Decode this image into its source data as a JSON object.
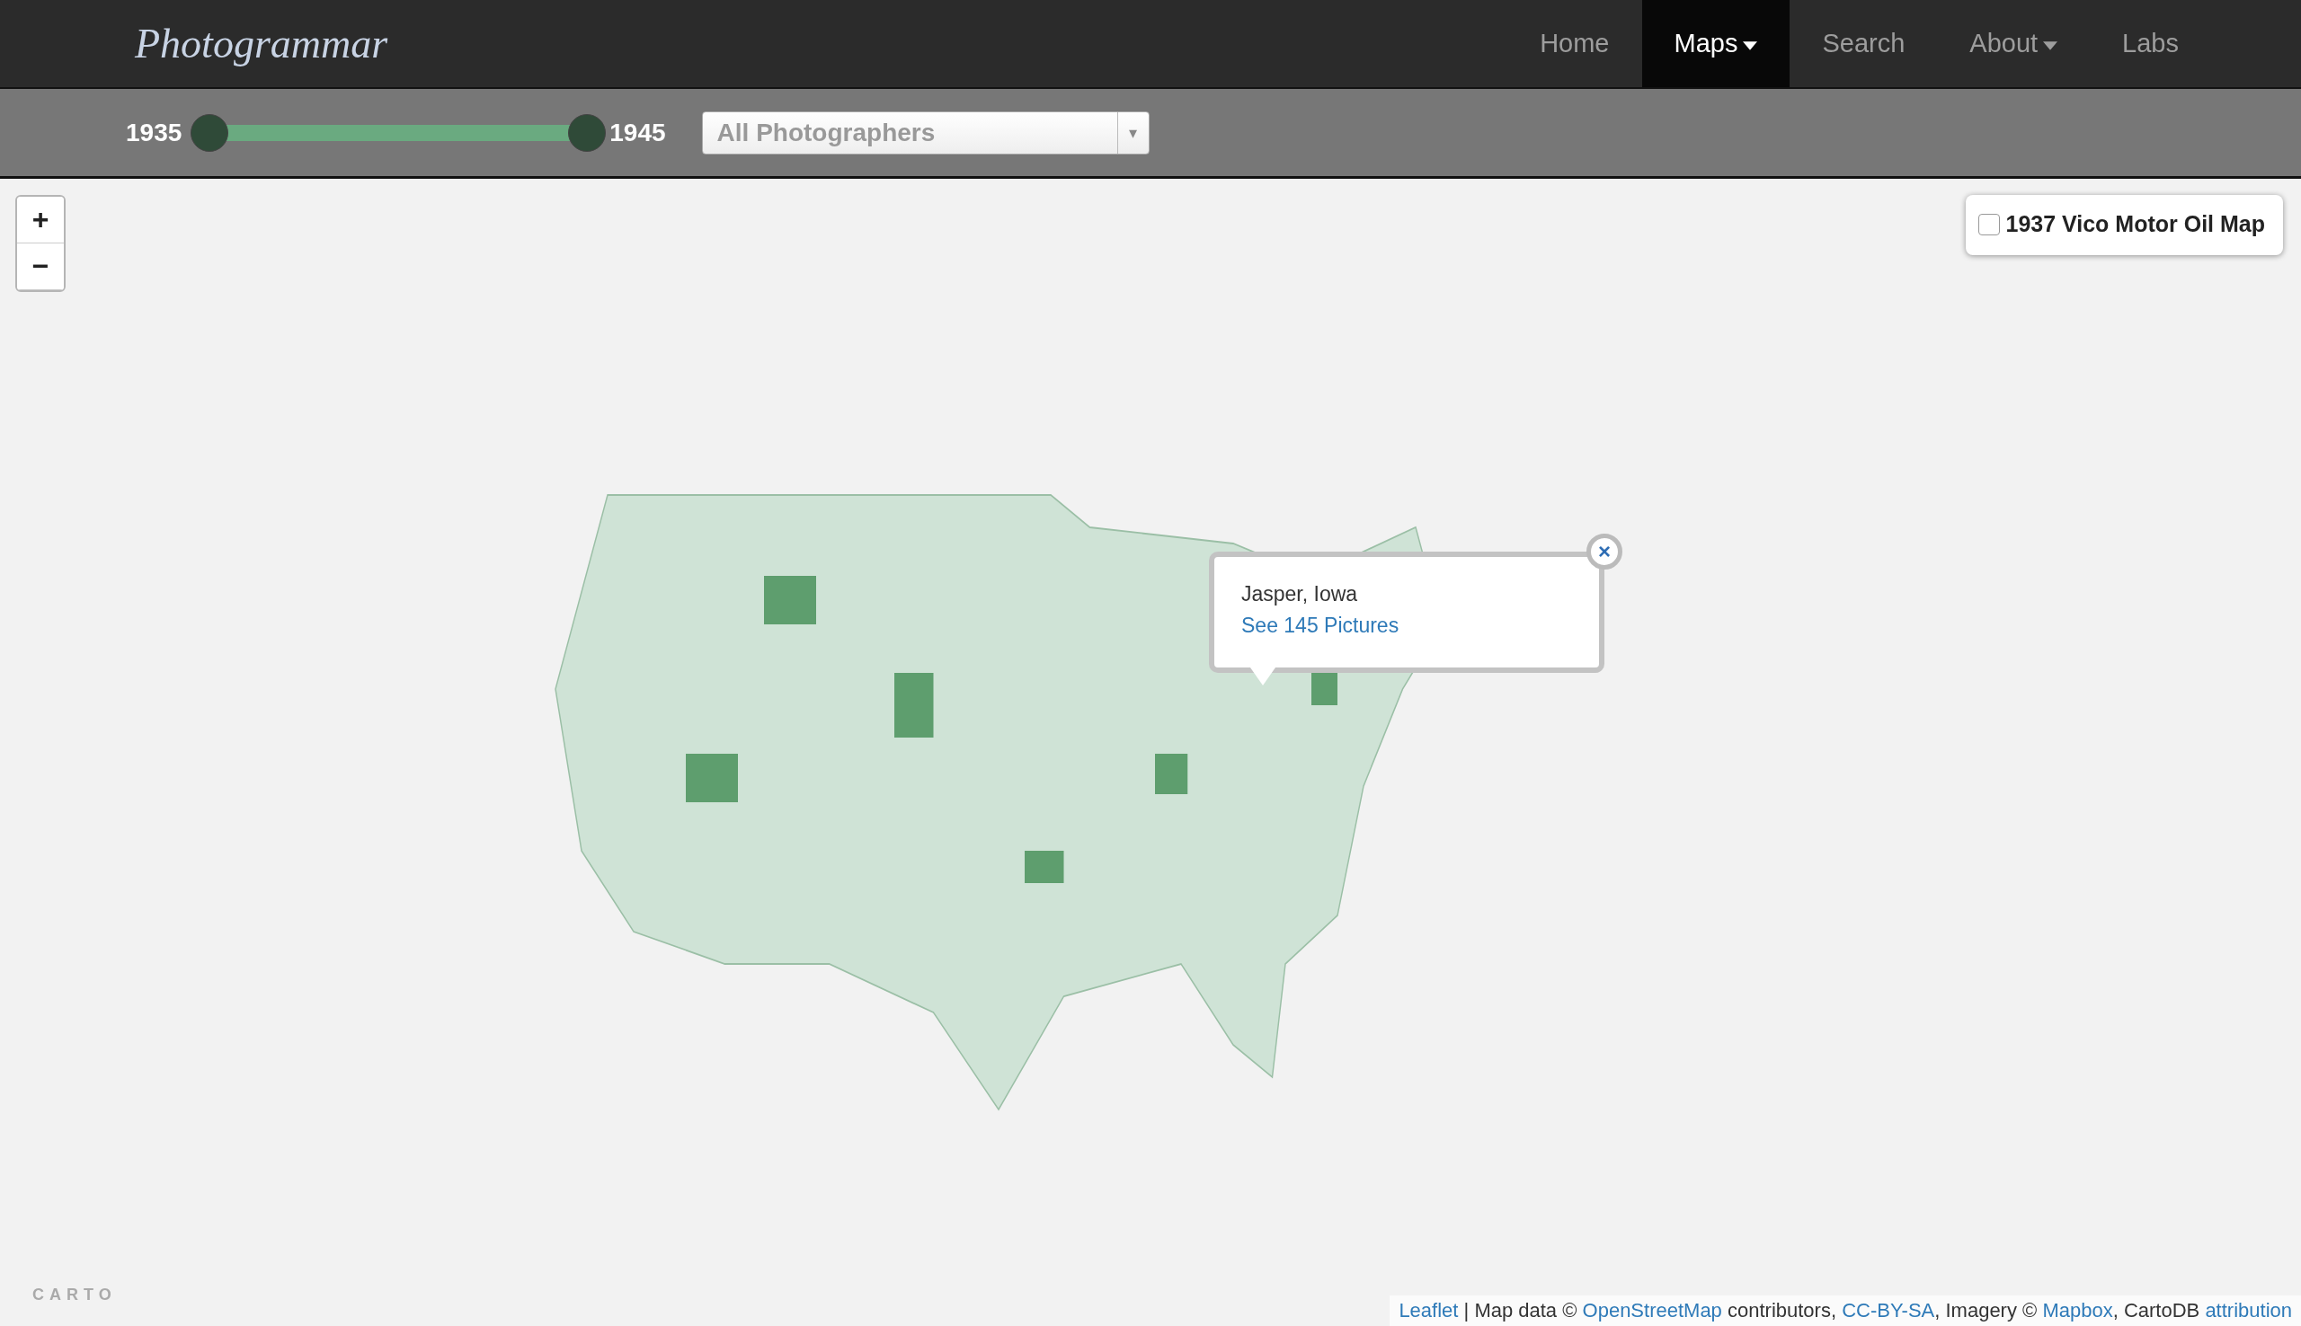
{
  "brand": "Photogrammar",
  "nav": [
    {
      "label": "Home",
      "selected": false,
      "dropdown": false
    },
    {
      "label": "Maps",
      "selected": true,
      "dropdown": true
    },
    {
      "label": "Search",
      "selected": false,
      "dropdown": false
    },
    {
      "label": "About",
      "selected": false,
      "dropdown": true
    },
    {
      "label": "Labs",
      "selected": false,
      "dropdown": false
    }
  ],
  "year_slider": {
    "start": {
      "label": "1935",
      "level": 0
    },
    "end": {
      "label": "1945",
      "level": 1
    }
  },
  "photographer_select": {
    "placeholder": "All Photographers",
    "caret": "▾"
  },
  "zoom_controls": [
    "+",
    "−"
  ],
  "overlay_toggle": {
    "label": "1937 Vico Motor Oil Map",
    "checked": false
  },
  "popup": {
    "title": "Jasper, Iowa",
    "link": "See 145 Pictures",
    "close": "×"
  },
  "carto_logo": "CARTO",
  "attribution": [
    {
      "kind": "link",
      "text": "Leaflet"
    },
    {
      "kind": "text",
      "text": " | Map data © "
    },
    {
      "kind": "link",
      "text": "OpenStreetMap"
    },
    {
      "kind": "text",
      "text": " contributors, "
    },
    {
      "kind": "link",
      "text": "CC-BY-SA"
    },
    {
      "kind": "text",
      "text": ", Imagery © "
    },
    {
      "kind": "link",
      "text": "Mapbox"
    },
    {
      "kind": "text",
      "text": ", CartoDB "
    },
    {
      "kind": "link",
      "text": "attribution"
    }
  ]
}
